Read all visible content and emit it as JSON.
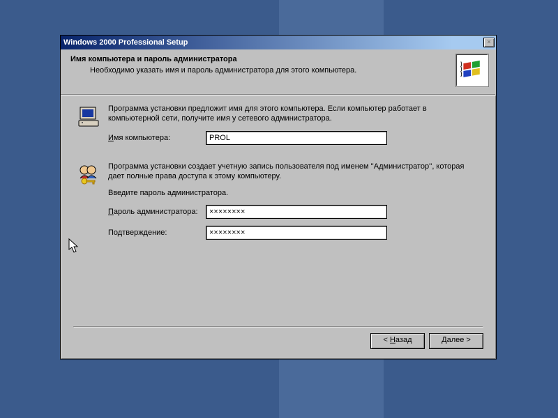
{
  "titlebar": {
    "text": "Windows 2000 Professional Setup",
    "close": "×"
  },
  "header": {
    "title": "Имя компьютера и пароль администратора",
    "subtitle": "Необходимо указать имя и пароль администратора для этого компьютера."
  },
  "section1": {
    "para": "Программа установки предложит имя для этого компьютера. Если компьютер работает в компьютерной сети, получите имя у сетевого администратора.",
    "label_accel": "И",
    "label_rest": "мя компьютера:",
    "value": "PROL"
  },
  "section2": {
    "para": "Программа установки создает учетную запись пользователя под именем ''Администратор'', которая дает полные права доступа к этому компьютеру.",
    "prompt": "Введите пароль администратора.",
    "pwd_label_accel": "П",
    "pwd_label_rest": "ароль администратора:",
    "pwd_value": "××××××××",
    "conf_label": "Подтверждение:",
    "conf_value": "××××××××"
  },
  "buttons": {
    "back_lt": "< ",
    "back_accel": "Н",
    "back_rest": "азад",
    "next_accel": "Д",
    "next_rest": "алее >"
  }
}
